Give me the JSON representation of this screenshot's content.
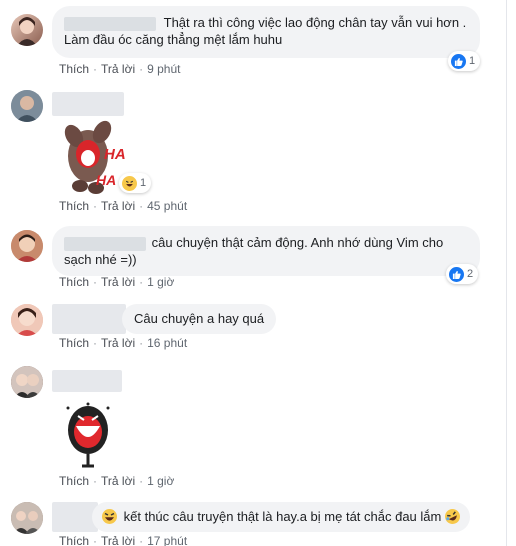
{
  "actions": {
    "like": "Thích",
    "reply": "Trả lời",
    "dot": "·"
  },
  "comments": [
    {
      "text_line1": "Thật ra thì công việc lao động chân tay vẫn vui hơn .",
      "text_line2": "Làm đầu óc căng thẳng mệt lắm huhu",
      "time": "9 phút",
      "reaction_count": "1",
      "reaction_icon": "like-icon"
    },
    {
      "sticker_label_1": "HA",
      "sticker_label_2": "HA",
      "time": "45 phút",
      "reaction_count": "1",
      "reaction_icon": "haha-icon"
    },
    {
      "text_line1": "câu chuyện thật cảm động. Anh nhớ dùng Vim cho",
      "text_line2": "sạch nhé =))",
      "time": "1 giờ",
      "reaction_count": "2",
      "reaction_icon": "like-icon"
    },
    {
      "text_line1": "Câu chuyện a hay quá",
      "time": "16 phút"
    },
    {
      "time": "1 giờ"
    },
    {
      "text_line1": "kết thúc câu truyện thật là hay.a bị mẹ tát chắc đau lắm",
      "time": "17 phút"
    }
  ],
  "colors": {
    "like_blue": "#1877f2",
    "haha_yellow": "#f7c84b",
    "bubble_bg": "#f2f3f5",
    "meta_gray": "#606770"
  }
}
